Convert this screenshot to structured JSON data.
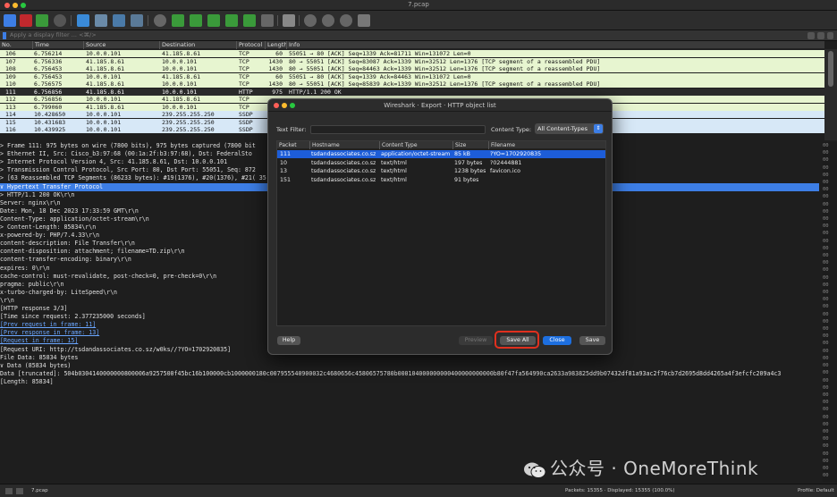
{
  "window": {
    "title": "7.pcap"
  },
  "toolbar": {
    "icons": [
      "shark-fin-start",
      "stop",
      "restart",
      "options",
      "open",
      "save",
      "close",
      "reload",
      "find",
      "go-back",
      "go-forward",
      "go-to-packet",
      "go-first",
      "go-last",
      "autoscroll",
      "colorize",
      "zoom-in",
      "zoom-out",
      "zoom-reset",
      "resize-columns"
    ]
  },
  "filter": {
    "placeholder": "Apply a display filter ... <⌘/>"
  },
  "packet_list": {
    "columns": [
      "No.",
      "Time",
      "Source",
      "Destination",
      "Protocol",
      "Length",
      "Info"
    ],
    "rows": [
      {
        "no": "106",
        "time": "6.756214",
        "src": "10.0.0.101",
        "dst": "41.185.8.61",
        "proto": "TCP",
        "len": "60",
        "info": "55051 → 80 [ACK] Seq=1339 Ack=81711 Win=131072 Len=0",
        "color": "#e7f5d0"
      },
      {
        "no": "107",
        "time": "6.756336",
        "src": "41.185.8.61",
        "dst": "10.0.0.101",
        "proto": "TCP",
        "len": "1430",
        "info": "80 → 55051 [ACK] Seq=83087 Ack=1339 Win=32512 Len=1376 [TCP segment of a reassembled PDU]",
        "color": "#e7f5d0"
      },
      {
        "no": "108",
        "time": "6.756453",
        "src": "41.185.8.61",
        "dst": "10.0.0.101",
        "proto": "TCP",
        "len": "1430",
        "info": "80 → 55051 [ACK] Seq=84463 Ack=1339 Win=32512 Len=1376 [TCP segment of a reassembled PDU]",
        "color": "#e7f5d0"
      },
      {
        "no": "109",
        "time": "6.756453",
        "src": "10.0.0.101",
        "dst": "41.185.8.61",
        "proto": "TCP",
        "len": "60",
        "info": "55051 → 80 [ACK] Seq=1339 Ack=84463 Win=131072 Len=0",
        "color": "#e7f5d0"
      },
      {
        "no": "110",
        "time": "6.756575",
        "src": "41.185.8.61",
        "dst": "10.0.0.101",
        "proto": "TCP",
        "len": "1430",
        "info": "80 → 55051 [ACK] Seq=85839 Ack=1339 Win=32512 Len=1376 [TCP segment of a reassembled PDU]",
        "color": "#e7f5d0"
      },
      {
        "no": "111",
        "time": "6.756856",
        "src": "41.185.8.61",
        "dst": "10.0.0.101",
        "proto": "HTTP",
        "len": "975",
        "info": "HTTP/1.1 200 OK",
        "color": "#2a2a2a",
        "selected": true
      },
      {
        "no": "112",
        "time": "6.756856",
        "src": "10.0.0.101",
        "dst": "41.185.8.61",
        "proto": "TCP",
        "len": "",
        "info": "",
        "color": "#e7f5d0"
      },
      {
        "no": "113",
        "time": "6.799060",
        "src": "41.185.8.61",
        "dst": "10.0.0.101",
        "proto": "TCP",
        "len": "",
        "info": "",
        "color": "#e7f5d0"
      },
      {
        "no": "114",
        "time": "10.428650",
        "src": "10.0.0.101",
        "dst": "239.255.255.250",
        "proto": "SSDP",
        "len": "",
        "info": "",
        "color": "#d7e8f7"
      },
      {
        "no": "115",
        "time": "10.431683",
        "src": "10.0.0.101",
        "dst": "239.255.255.250",
        "proto": "SSDP",
        "len": "",
        "info": "",
        "color": "#d7e8f7"
      },
      {
        "no": "116",
        "time": "10.439925",
        "src": "10.0.0.101",
        "dst": "239.255.255.250",
        "proto": "SSDP",
        "len": "",
        "info": "",
        "color": "#d7e8f7"
      }
    ]
  },
  "details": [
    {
      "text": ">  Frame 111: 975 bytes on wire (7800 bits), 975 bytes captured (7800 bit"
    },
    {
      "text": ">  Ethernet II, Src: Cisco_b3:97:68 (00:1a:2f:b3:97:68), Dst: FederalSto"
    },
    {
      "text": ">  Internet Protocol Version 4, Src: 41.185.8.61, Dst: 10.0.0.101"
    },
    {
      "text": ">  Transmission Control Protocol, Src Port: 80, Dst Port: 55051, Seq: 872"
    },
    {
      "text": ">  [63 Reassembled TCP Segments (86233 bytes): #19(1376), #20(1376), #21(                                                                                                35(1376), #36(1376), #38(1376), #40(1376), #41(1376), #4"
    },
    {
      "text": "∨  Hypertext Transfer Protocol",
      "sel": true
    },
    {
      "text": "   >  HTTP/1.1 200 OK\\r\\n"
    },
    {
      "text": "      Server: nginx\\r\\n"
    },
    {
      "text": "      Date: Mon, 18 Dec 2023 17:33:59 GMT\\r\\n"
    },
    {
      "text": "      Content-Type: application/octet-stream\\r\\n"
    },
    {
      "text": "   >  Content-Length: 85834\\r\\n"
    },
    {
      "text": "      x-powered-by: PHP/7.4.33\\r\\n"
    },
    {
      "text": "      content-description: File Transfer\\r\\n"
    },
    {
      "text": "      content-disposition: attachment; filename=TD.zip\\r\\n"
    },
    {
      "text": "      content-transfer-encoding: binary\\r\\n"
    },
    {
      "text": "      expires: 0\\r\\n"
    },
    {
      "text": "      cache-control: must-revalidate, post-check=0, pre-check=0\\r\\n"
    },
    {
      "text": "      pragma: public\\r\\n"
    },
    {
      "text": "      x-turbo-charged-by: LiteSpeed\\r\\n"
    },
    {
      "text": "      \\r\\n"
    },
    {
      "text": "      [HTTP response 3/3]"
    },
    {
      "text": "      [Time since request: 2.377235000 seconds]"
    },
    {
      "text": "      [Prev request in frame: 11]",
      "link": true
    },
    {
      "text": "      [Prev response in frame: 13]",
      "link": true
    },
    {
      "text": "      [Request in frame: 15]",
      "link": true
    },
    {
      "text": "      [Request URI: http://tsdandassociates.co.sz/w0ks//?YO=1702920835]"
    },
    {
      "text": "      File Data: 85834 bytes"
    },
    {
      "text": "∨  Data (85834 bytes)"
    },
    {
      "text": "      Data [truncated]: 504b0304140000000800006a9257500f45bc16b100000cb1000000180c007955540900032c4680656c45806575780b000104000000000400000000000b80f47fa564990ca2633a983825dd9b07432df81a93ac2f76cb7d2695d8dd4265a4f3efcfc209a4c3"
    },
    {
      "text": "      [Length: 85834]"
    }
  ],
  "hex_strip": [
    "00",
    "00",
    "00",
    "00",
    "00",
    "00",
    "00",
    "00",
    "00",
    "00",
    "00",
    "00",
    "00",
    "00",
    "00",
    "00",
    "00",
    "00",
    "00",
    "00",
    "00",
    "00",
    "00",
    "00",
    "00",
    "00",
    "00",
    "00",
    "00",
    "00",
    "00",
    "00",
    "00",
    "00",
    "00",
    "00",
    "00",
    "00",
    "00",
    "00",
    "00",
    "00",
    "00",
    "00",
    "00",
    "00"
  ],
  "dialog": {
    "title": "Wireshark · Export · HTTP object list",
    "text_filter_label": "Text Filter:",
    "content_type_label": "Content Type:",
    "content_type_value": "All Content-Types",
    "columns": [
      "Packet",
      "Hostname",
      "Content Type",
      "Size",
      "Filename"
    ],
    "rows": [
      {
        "packet": "111",
        "hostname": "tsdandassociates.co.sz",
        "ctype": "application/octet-stream",
        "size": "85 kB",
        "filename": "?YO=1702920835",
        "selected": true
      },
      {
        "packet": "10",
        "hostname": "tsdandassociates.co.sz",
        "ctype": "text/html",
        "size": "197 bytes",
        "filename": "?02444881"
      },
      {
        "packet": "13",
        "hostname": "tsdandassociates.co.sz",
        "ctype": "text/html",
        "size": "1238 bytes",
        "filename": "favicon.ico"
      },
      {
        "packet": "151",
        "hostname": "tsdandassociates.co.sz",
        "ctype": "text/html",
        "size": "91 bytes",
        "filename": ""
      }
    ],
    "buttons": {
      "help": "Help",
      "preview": "Preview",
      "save_all": "Save All",
      "close": "Close",
      "save": "Save"
    }
  },
  "status": {
    "file": "7.pcap",
    "packets": "Packets: 15355 · Displayed: 15355 (100.0%)",
    "profile": "Profile: Default"
  },
  "watermark": {
    "text": "公众号 · OneMoreThink"
  },
  "colors": {
    "accent": "#3d7ee5",
    "highlight": "#e0301e",
    "http_row": "#e7f5d0",
    "ssdp_row": "#d7e8f7"
  }
}
